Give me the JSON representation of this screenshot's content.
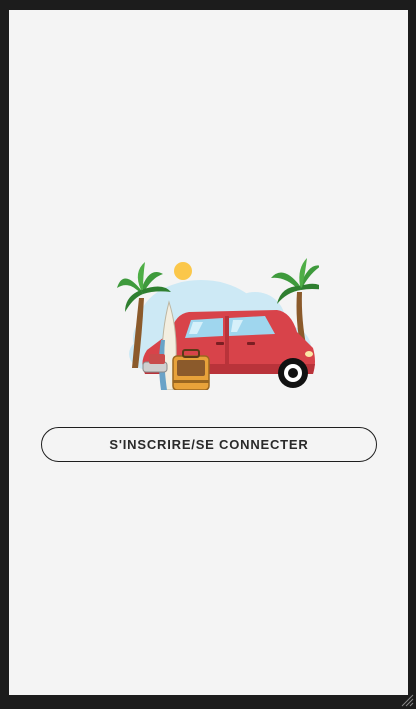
{
  "auth": {
    "button_label": "S'INSCRIRE/SE CONNECTER"
  },
  "illustration": {
    "subject": "travel-car-beach-illustration",
    "colors": {
      "car": "#d8434a",
      "car_dark": "#b9333a",
      "window": "#9fd6ee",
      "cloud": "#cde9f5",
      "sun": "#fbc74a",
      "palm_leaf": "#3e9a3c",
      "palm_trunk": "#8b5a2b",
      "suitcase": "#e8a23a",
      "surfboard": "#f3eee0"
    }
  },
  "colors": {
    "background": "#f4f4f4",
    "frame": "#1c1c1c",
    "button_border": "#1e1e1e",
    "button_text": "#2a2a2a"
  }
}
